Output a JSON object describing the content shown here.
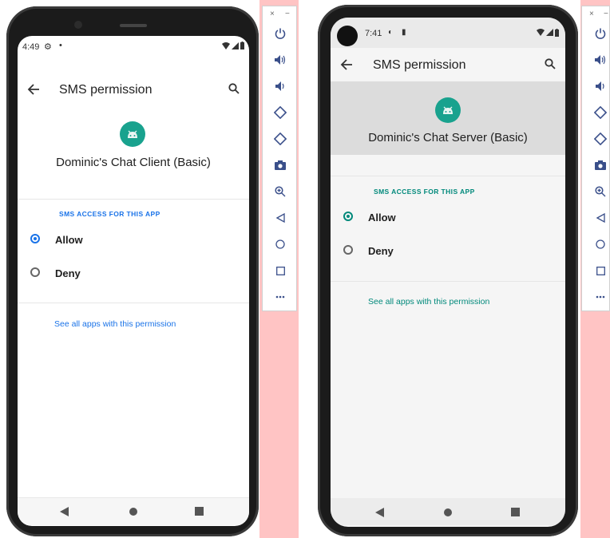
{
  "left_device": {
    "status": {
      "time": "4:49"
    },
    "appbar": {
      "title": "SMS permission"
    },
    "app_name": "Dominic's Chat Client (Basic)",
    "section_label": "SMS ACCESS FOR THIS APP",
    "options": [
      {
        "label": "Allow",
        "selected": true
      },
      {
        "label": "Deny",
        "selected": false
      }
    ],
    "link": "See all apps with this permission",
    "accent": "#1a73e8"
  },
  "right_device": {
    "status": {
      "time": "7:41"
    },
    "appbar": {
      "title": "SMS permission"
    },
    "app_name": "Dominic's Chat Server (Basic)",
    "section_label": "SMS ACCESS FOR THIS APP",
    "options": [
      {
        "label": "Allow",
        "selected": true
      },
      {
        "label": "Deny",
        "selected": false
      }
    ],
    "link": "See all apps with this permission",
    "accent": "#00897b"
  },
  "toolbar": {
    "window_controls": [
      "×",
      "−"
    ],
    "buttons": [
      "power-icon",
      "volume-up-icon",
      "volume-down-icon",
      "rotate-left-icon",
      "rotate-right-icon",
      "camera-icon",
      "zoom-icon",
      "back-icon",
      "home-icon",
      "overview-icon",
      "more-icon"
    ]
  }
}
